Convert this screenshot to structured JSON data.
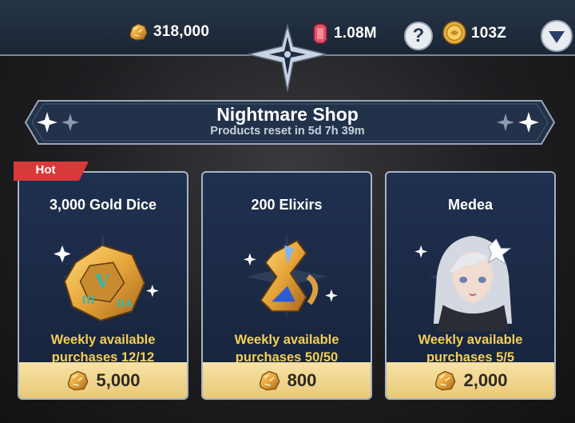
{
  "resources": {
    "gold": "318,000",
    "gems": "1.08M",
    "coins": "103Z"
  },
  "icons": {
    "gold": "gold-nugget-icon",
    "gems": "red-gem-icon",
    "coins": "gold-coin-icon",
    "help": "question-mark-icon",
    "menu": "chevron-down-icon"
  },
  "help_label": "?",
  "shop": {
    "title": "Nightmare Shop",
    "reset_text": "Products reset in 5d 7h 39m"
  },
  "products": [
    {
      "name": "3,000 Gold Dice",
      "limit_line1": "Weekly available",
      "limit_line2": "purchases 12/12",
      "price": "5,000",
      "tag": "Hot"
    },
    {
      "name": "200 Elixirs",
      "limit_line1": "Weekly available",
      "limit_line2": "purchases 50/50",
      "price": "800"
    },
    {
      "name": "Medea",
      "limit_line1": "Weekly available",
      "limit_line2": "purchases 5/5",
      "price": "2,000"
    }
  ],
  "colors": {
    "topbar": "#1f2c3d",
    "card_bg": "#1f3050",
    "price_bar": "#f2d88f",
    "limit_text": "#f3cf56",
    "hot_tag": "#d83a3a"
  }
}
